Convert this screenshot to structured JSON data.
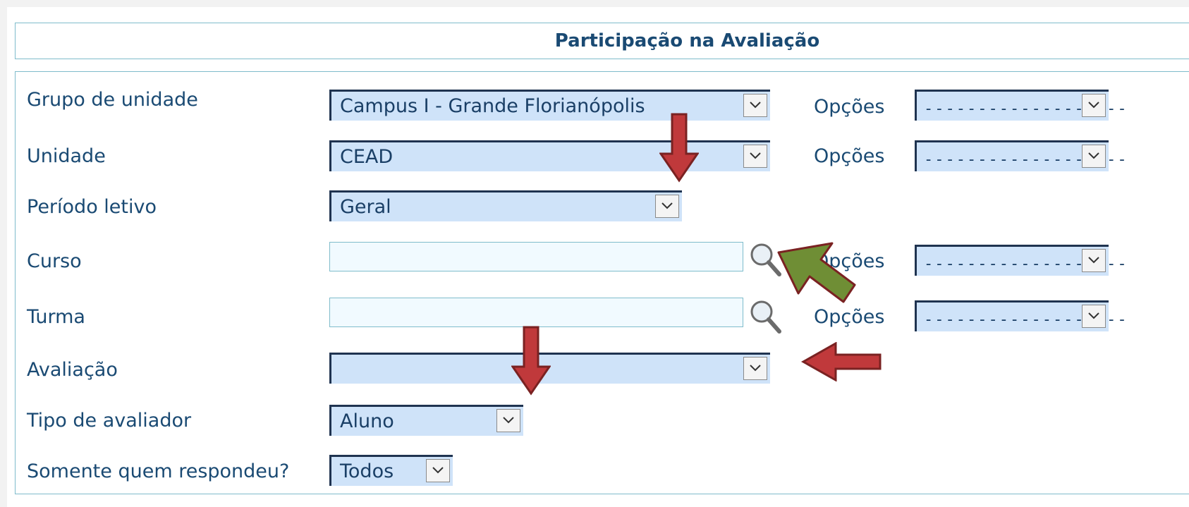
{
  "header": {
    "title": "Participação na Avaliação"
  },
  "form": {
    "grupo": {
      "label": "Grupo de unidade",
      "value": "Campus I - Grande Florianópolis",
      "options_label": "Opções",
      "options_value": "-------------------"
    },
    "unidade": {
      "label": "Unidade",
      "value": "CEAD",
      "options_label": "Opções",
      "options_value": "-------------------"
    },
    "periodo": {
      "label": "Período letivo",
      "value": "Geral"
    },
    "curso": {
      "label": "Curso",
      "value": "",
      "options_label": "Opções",
      "options_value": "-------------------"
    },
    "turma": {
      "label": "Turma",
      "value": "",
      "options_label": "Opções",
      "options_value": "-------------------"
    },
    "avaliacao": {
      "label": "Avaliação",
      "value": ""
    },
    "tipo": {
      "label": "Tipo de avaliador",
      "value": "Aluno"
    },
    "somente": {
      "label": "Somente quem respondeu?",
      "value": "Todos"
    }
  },
  "colors": {
    "arrow_red": "#c0393b",
    "arrow_green": "#6f8e35",
    "select_bg": "#cfe3f9",
    "text": "#1a4a73"
  },
  "icons": [
    "search-icon",
    "chevron-down-icon",
    "arrow-down-icon",
    "arrow-left-icon",
    "arrow-up-left-icon"
  ]
}
